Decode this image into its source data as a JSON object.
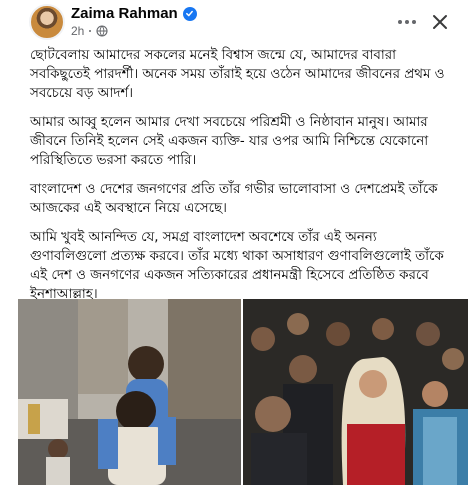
{
  "post": {
    "author": "Zaima Rahman",
    "time": "2h",
    "paragraphs": [
      "ছোটবেলায় আমাদের সকলের মনেই বিশ্বাস জন্মে যে, আমাদের বাবারা সবকিছুতেই পারদর্শী। অনেক সময় তাঁরাই হয়ে ওঠেন আমাদের জীবনের প্রথম ও সবচেয়ে বড় আদর্শ।",
      "আমার আব্বু হলেন আমার দেখা সবচেয়ে পরিশ্রমী ও নিষ্ঠাবান মানুষ। আমার জীবনে তিনিই হলেন সেই একজন ব্যক্তি- যার ওপর আমি নিশ্চিন্তে যেকোনো পরিস্থিতিতে ভরসা করতে পারি।",
      "বাংলাদেশ ও দেশের জনগণের প্রতি তাঁর গভীর ভালোবাসা ও দেশপ্রেমই তাঁকে আজকের এই অবস্থানে নিয়ে এসেছে।",
      "আমি খুবই আনন্দিত যে, সমগ্র বাংলাদেশ অবশেষে তাঁর এই অনন্য গুণাবলিগুলো প্রত্যক্ষ করবে। তাঁর মধ্যে থাকা অসাধারণ গুণাবলিগুলোই তাঁকে এই দেশ ও জনগণের একজন সত্যিকারের প্রধানমন্ত্রী হিসেবে প্রতিষ্ঠিত করবে ইনশাআল্লাহ।"
    ]
  },
  "icons": {
    "verified": "verified-badge-icon",
    "audience": "globe-icon",
    "more": "more-options-icon",
    "close": "close-icon"
  },
  "colors": {
    "verified_blue": "#1877f2",
    "secondary_text": "#65676b"
  }
}
